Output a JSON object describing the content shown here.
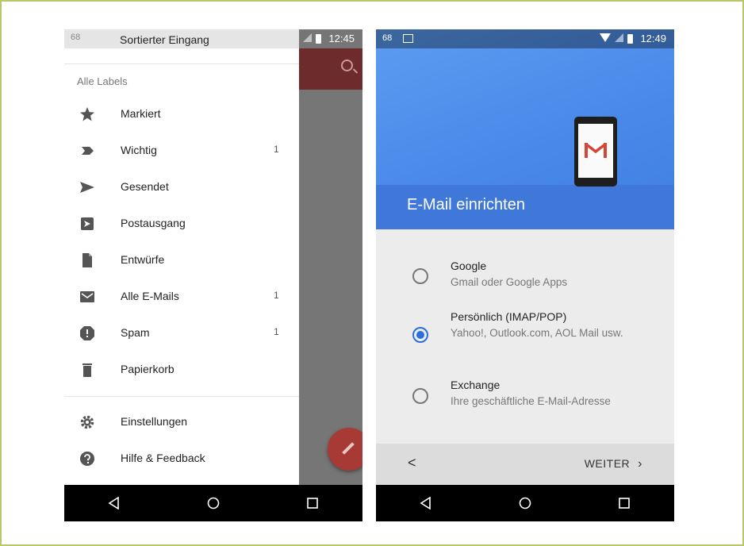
{
  "left_screen": {
    "status": {
      "time": "12:45",
      "app_badge": "68"
    },
    "drawer": {
      "header_title": "Sortierter Eingang",
      "section_label": "Alle Labels",
      "items": [
        {
          "label": "Markiert",
          "count": "",
          "icon": "star-icon"
        },
        {
          "label": "Wichtig",
          "count": "1",
          "icon": "important-icon"
        },
        {
          "label": "Gesendet",
          "count": "",
          "icon": "send-icon"
        },
        {
          "label": "Postausgang",
          "count": "",
          "icon": "outbox-icon"
        },
        {
          "label": "Entwürfe",
          "count": "",
          "icon": "draft-icon"
        },
        {
          "label": "Alle E-Mails",
          "count": "1",
          "icon": "all-mail-icon"
        },
        {
          "label": "Spam",
          "count": "1",
          "icon": "spam-icon"
        },
        {
          "label": "Papierkorb",
          "count": "",
          "icon": "trash-icon"
        }
      ],
      "settings_items": [
        {
          "label": "Einstellungen",
          "icon": "gear-icon"
        },
        {
          "label": "Hilfe & Feedback",
          "icon": "help-icon"
        }
      ]
    }
  },
  "right_screen": {
    "status": {
      "time": "12:49",
      "app_badge": "68"
    },
    "title": "E-Mail einrichten",
    "options": [
      {
        "title": "Google",
        "subtitle": "Gmail oder Google Apps",
        "selected": false
      },
      {
        "title": "Persönlich (IMAP/POP)",
        "subtitle": "Yahoo!, Outlook.com, AOL Mail usw.",
        "selected": true
      },
      {
        "title": "Exchange",
        "subtitle": "Ihre geschäftliche E-Mail-Adresse",
        "selected": false
      }
    ],
    "footer": {
      "back_label": "<",
      "next_label": "WEITER"
    }
  },
  "colors": {
    "accent": "#4285f4",
    "gmail_red": "#d44638",
    "frame": "#b5c96a"
  }
}
